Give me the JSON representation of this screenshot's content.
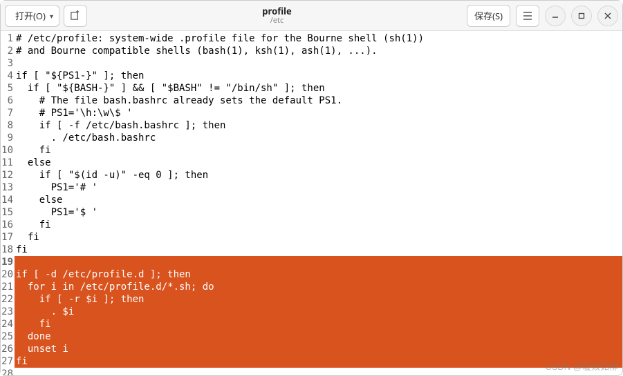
{
  "header": {
    "open_label": "打开(O)",
    "save_label": "保存(S)",
    "title": "profile",
    "subtitle": "/etc"
  },
  "icons": {
    "chevron_down": "▾",
    "new_tab": "new-tab",
    "hamburger": "menu",
    "minimize": "—",
    "maximize": "□",
    "close": "×"
  },
  "watermark": "CSDN @璇焱如柳",
  "code_lines": [
    "# /etc/profile: system-wide .profile file for the Bourne shell (sh(1))",
    "# and Bourne compatible shells (bash(1), ksh(1), ash(1), ...).",
    "",
    "if [ \"${PS1-}\" ]; then",
    "  if [ \"${BASH-}\" ] && [ \"$BASH\" != \"/bin/sh\" ]; then",
    "    # The file bash.bashrc already sets the default PS1.",
    "    # PS1='\\h:\\w\\$ '",
    "    if [ -f /etc/bash.bashrc ]; then",
    "      . /etc/bash.bashrc",
    "    fi",
    "  else",
    "    if [ \"$(id -u)\" -eq 0 ]; then",
    "      PS1='# '",
    "    else",
    "      PS1='$ '",
    "    fi",
    "  fi",
    "fi",
    "",
    "if [ -d /etc/profile.d ]; then",
    "  for i in /etc/profile.d/*.sh; do",
    "    if [ -r $i ]; then",
    "      . $i",
    "    fi",
    "  done",
    "  unset i",
    "fi",
    ""
  ],
  "current_line": 19,
  "selection_start": 19,
  "selection_end": 27
}
